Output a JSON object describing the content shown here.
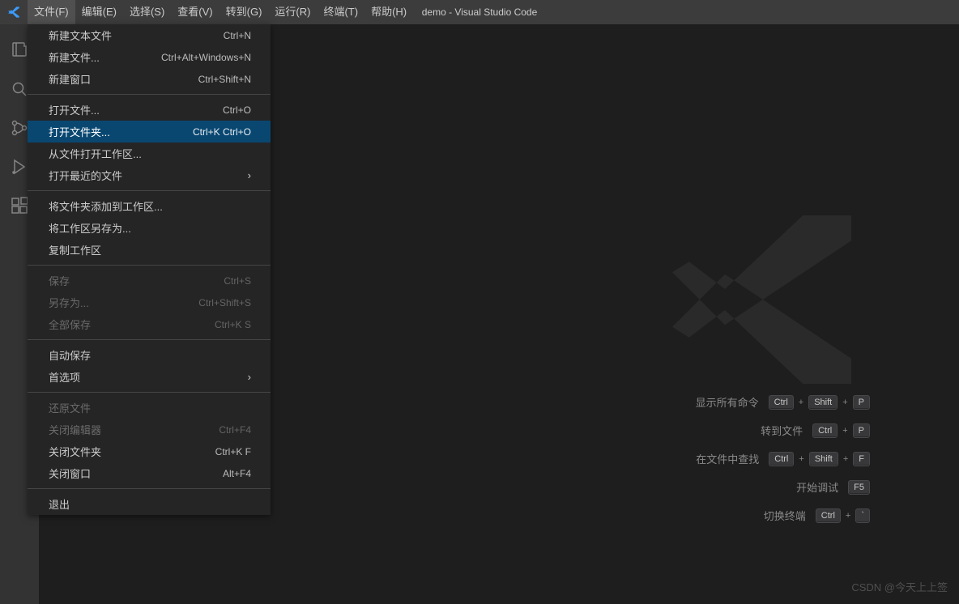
{
  "title": "demo - Visual Studio Code",
  "menubar": {
    "file": "文件(F)",
    "edit": "编辑(E)",
    "select": "选择(S)",
    "view": "查看(V)",
    "goto": "转到(G)",
    "run": "运行(R)",
    "terminal": "终端(T)",
    "help": "帮助(H)"
  },
  "dropdown": {
    "new_text_file": {
      "label": "新建文本文件",
      "shortcut": "Ctrl+N"
    },
    "new_file": {
      "label": "新建文件...",
      "shortcut": "Ctrl+Alt+Windows+N"
    },
    "new_window": {
      "label": "新建窗口",
      "shortcut": "Ctrl+Shift+N"
    },
    "open_file": {
      "label": "打开文件...",
      "shortcut": "Ctrl+O"
    },
    "open_folder": {
      "label": "打开文件夹...",
      "shortcut": "Ctrl+K Ctrl+O"
    },
    "open_workspace": {
      "label": "从文件打开工作区..."
    },
    "open_recent": {
      "label": "打开最近的文件"
    },
    "add_folder": {
      "label": "将文件夹添加到工作区..."
    },
    "save_workspace_as": {
      "label": "将工作区另存为..."
    },
    "duplicate_workspace": {
      "label": "复制工作区"
    },
    "save": {
      "label": "保存",
      "shortcut": "Ctrl+S"
    },
    "save_as": {
      "label": "另存为...",
      "shortcut": "Ctrl+Shift+S"
    },
    "save_all": {
      "label": "全部保存",
      "shortcut": "Ctrl+K S"
    },
    "auto_save": {
      "label": "自动保存"
    },
    "preferences": {
      "label": "首选项"
    },
    "revert_file": {
      "label": "还原文件"
    },
    "close_editor": {
      "label": "关闭编辑器",
      "shortcut": "Ctrl+F4"
    },
    "close_folder": {
      "label": "关闭文件夹",
      "shortcut": "Ctrl+K F"
    },
    "close_window": {
      "label": "关闭窗口",
      "shortcut": "Alt+F4"
    },
    "exit": {
      "label": "退出"
    }
  },
  "hints": {
    "show_commands": {
      "label": "显示所有命令",
      "keys": [
        "Ctrl",
        "Shift",
        "P"
      ]
    },
    "goto_file": {
      "label": "转到文件",
      "keys": [
        "Ctrl",
        "P"
      ]
    },
    "find_in_files": {
      "label": "在文件中查找",
      "keys": [
        "Ctrl",
        "Shift",
        "F"
      ]
    },
    "start_debug": {
      "label": "开始调试",
      "keys": [
        "F5"
      ]
    },
    "toggle_terminal": {
      "label": "切换终端",
      "keys": [
        "Ctrl",
        "`"
      ]
    }
  },
  "watermark": "CSDN @今天上上签"
}
